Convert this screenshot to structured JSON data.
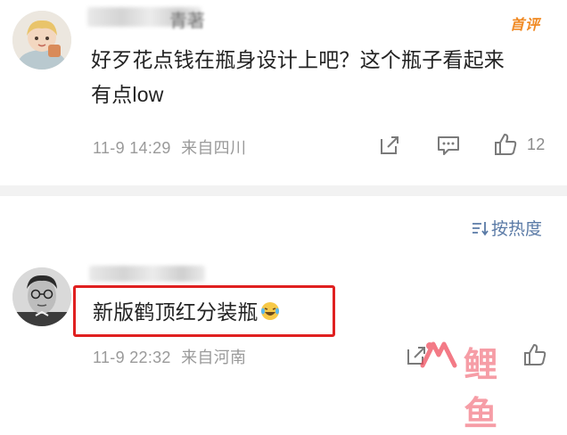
{
  "comments": [
    {
      "avatar": "cartoon-child-avatar",
      "username_visible": "青著",
      "badge": "首评",
      "text": "好歹花点钱在瓶身设计上吧？这个瓶子看起来有点low",
      "text_line1": "好歹花点钱在瓶身设计上吧？这个瓶子看起来",
      "text_line2": "有点low",
      "timestamp": "11-9 14:29",
      "location": "来自四川",
      "like_count": "12"
    },
    {
      "avatar": "vintage-portrait-avatar",
      "text": "新版鹤顶红分装瓶",
      "emoji": "laughing-crying-emoji",
      "timestamp": "11-9 22:32",
      "location": "来自河南"
    }
  ],
  "sort": {
    "label": "按热度",
    "icon": "sort-icon"
  },
  "watermark": {
    "text": "鲤鱼"
  },
  "colors": {
    "accent_orange": "#f08a24",
    "link_blue": "#5a7aa6",
    "highlight_red": "#e02020",
    "meta_gray": "#9a9a9a"
  }
}
